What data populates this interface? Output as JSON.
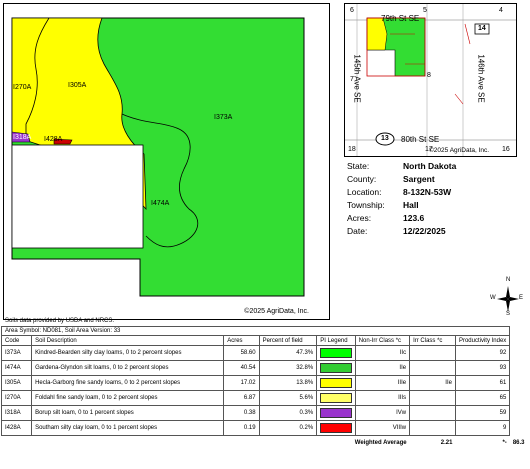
{
  "main_map": {
    "labels": [
      "I270A",
      "I305A",
      "I373A",
      "I474A",
      "I318A",
      "I428A"
    ],
    "copyright": "©2025 AgriData, Inc."
  },
  "inset_map": {
    "road_79": "79th St SE",
    "road_80": "80th St SE",
    "avenue_145": "145th Ave SE",
    "avenue_146": "146th Ave SE",
    "sections": [
      "6",
      "5",
      "4",
      "7",
      "8",
      "18",
      "17",
      "16"
    ],
    "shields": [
      "14",
      "13"
    ],
    "copyright": "©2025 AgriData, Inc."
  },
  "info": {
    "state_label": "State:",
    "state": "North Dakota",
    "county_label": "County:",
    "county": "Sargent",
    "location_label": "Location:",
    "location": "8-132N-53W",
    "township_label": "Township:",
    "township": "Hall",
    "acres_label": "Acres:",
    "acres": "123.6",
    "date_label": "Date:",
    "date": "12/22/2025"
  },
  "compass": {
    "n": "N",
    "s": "S",
    "e": "E",
    "w": "W"
  },
  "source_note": "Soils data provided by USDA and NRCS.",
  "table": {
    "title": "Area Symbol: ND081, Soil Area Version: 33",
    "headers": [
      "Code",
      "Soil Description",
      "Acres",
      "Percent of field",
      "PI Legend",
      "Non-Irr Class *c",
      "Irr Class *c",
      "Productivity Index"
    ],
    "rows": [
      {
        "code": "I373A",
        "desc": "Kindred-Bearden silty clay loams, 0 to 2 percent slopes",
        "acres": "58.60",
        "pct": "47.3%",
        "color": "#00ff00",
        "nonirr": "IIc",
        "irr": "",
        "pi": "92"
      },
      {
        "code": "I474A",
        "desc": "Gardena-Glyndon silt loams, 0 to 2 percent slopes",
        "acres": "40.54",
        "pct": "32.8%",
        "color": "#33cc33",
        "nonirr": "IIe",
        "irr": "",
        "pi": "93"
      },
      {
        "code": "I305A",
        "desc": "Hecla-Garborg fine sandy loams, 0 to 2 percent slopes",
        "acres": "17.02",
        "pct": "13.8%",
        "color": "#ffff00",
        "nonirr": "IIIe",
        "irr": "IIe",
        "pi": "61"
      },
      {
        "code": "I270A",
        "desc": "Foldahl fine sandy loam, 0 to 2 percent slopes",
        "acres": "6.87",
        "pct": "5.6%",
        "color": "#ffff66",
        "nonirr": "IIIs",
        "irr": "",
        "pi": "65"
      },
      {
        "code": "I318A",
        "desc": "Borup silt loam, 0 to 1 percent slopes",
        "acres": "0.38",
        "pct": "0.3%",
        "color": "#9933cc",
        "nonirr": "IVw",
        "irr": "",
        "pi": "59"
      },
      {
        "code": "I428A",
        "desc": "Southam silty clay loam, 0 to 1 percent slopes",
        "acres": "0.19",
        "pct": "0.2%",
        "color": "#ff0000",
        "nonirr": "VIIIw",
        "irr": "",
        "pi": "9"
      }
    ],
    "footer": {
      "label": "Weighted Average",
      "nonirr": "2.21",
      "irr": "*-",
      "pi": "86.3"
    }
  }
}
